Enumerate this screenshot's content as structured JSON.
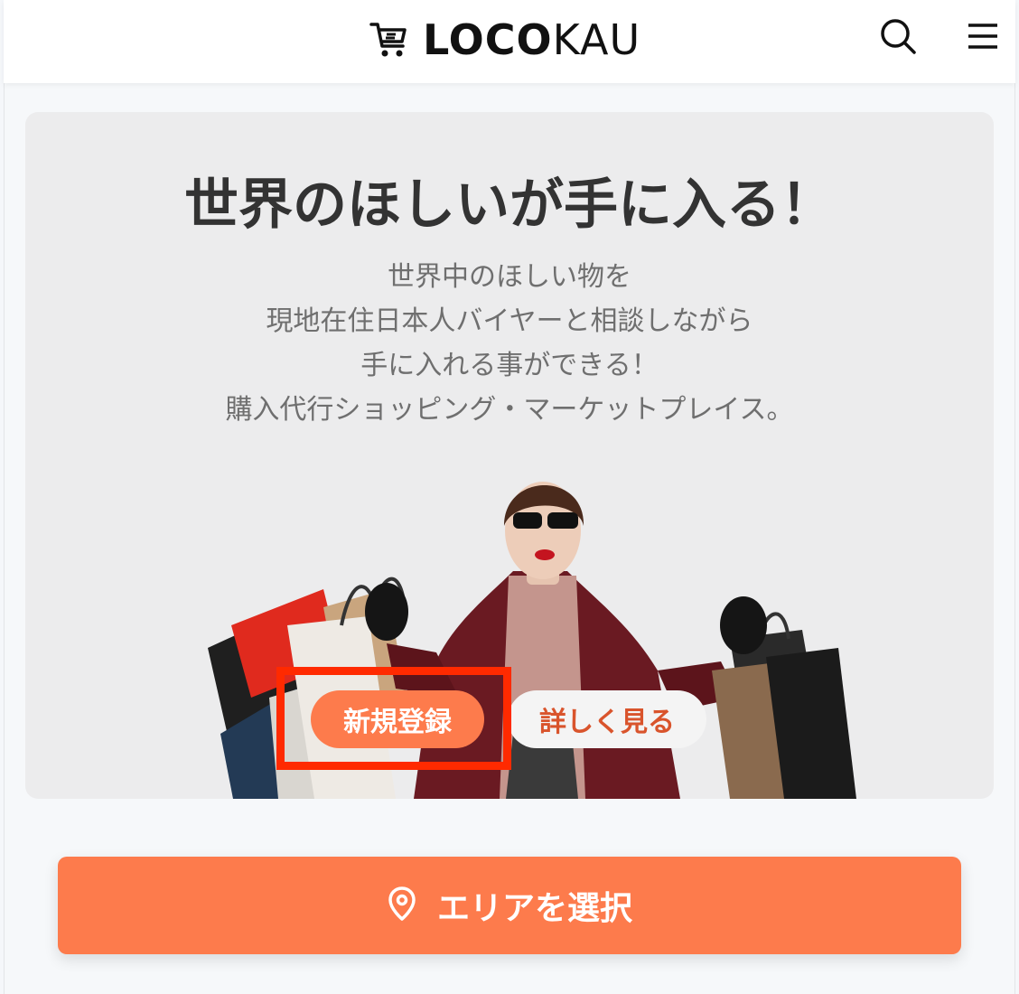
{
  "header": {
    "logo_bold": "LOCO",
    "logo_light": "KAU",
    "search_icon": "search-icon",
    "menu_icon": "hamburger-menu-icon"
  },
  "hero": {
    "title": "世界のほしいが手に入る！",
    "description_lines": [
      "世界中のほしい物を",
      "現地在住日本人バイヤーと相談しながら",
      "手に入れる事ができる！",
      "購入代行ショッピング・マーケットプレイス。"
    ],
    "register_label": "新規登録",
    "details_label": "詳しく見る"
  },
  "area_button": {
    "label": "エリアを選択",
    "icon": "map-pin-icon"
  },
  "colors": {
    "accent": "#fd7b4c",
    "highlight": "#ff2a00",
    "hero_bg": "#ececed",
    "details_text": "#d9542c"
  }
}
